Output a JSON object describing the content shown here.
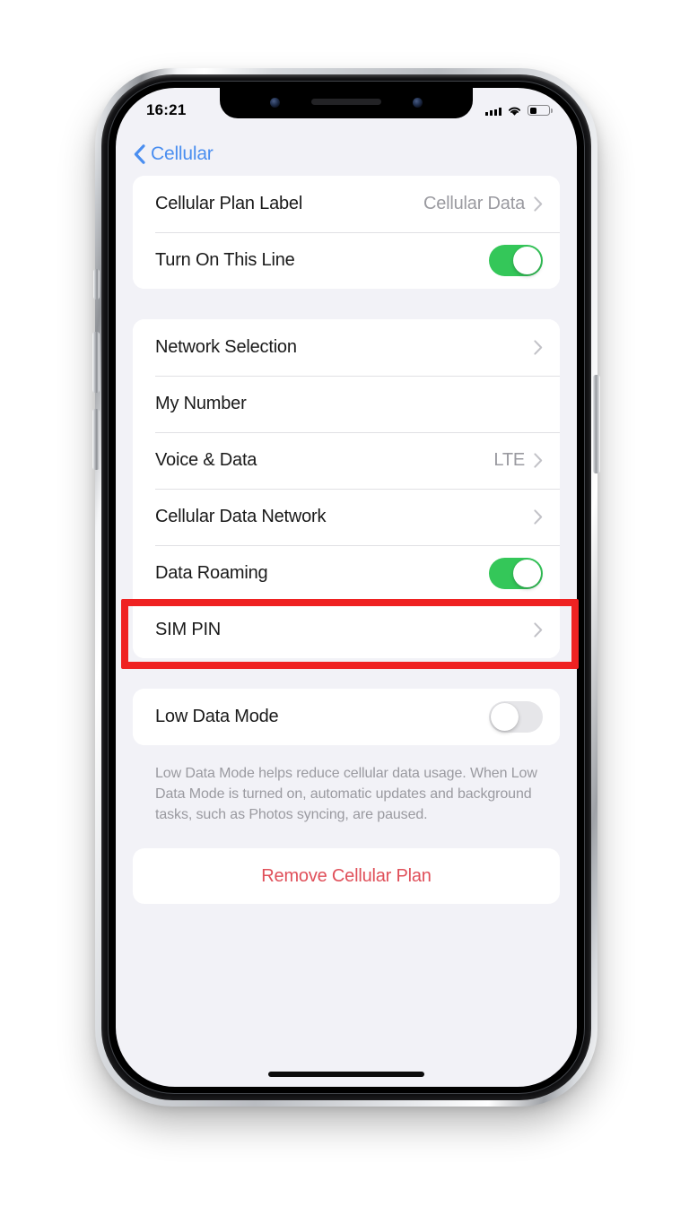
{
  "status_bar": {
    "time": "16:21",
    "cellular_icon": "cellular-bars-icon",
    "wifi_icon": "wifi-icon",
    "battery_icon": "battery-icon",
    "battery_level_percent": 32
  },
  "nav": {
    "back_icon": "chevron-left-icon",
    "back_label": "Cellular"
  },
  "groups": [
    {
      "rows": [
        {
          "label": "Cellular Plan Label",
          "value": "Cellular Data",
          "accessory": "chevron",
          "name": "row-cellular-plan-label"
        },
        {
          "label": "Turn On This Line",
          "accessory": "toggle",
          "toggle_state": "on",
          "name": "row-turn-on-this-line"
        }
      ]
    },
    {
      "rows": [
        {
          "label": "Network Selection",
          "value": "",
          "accessory": "chevron",
          "name": "row-network-selection"
        },
        {
          "label": "My Number",
          "value": "",
          "accessory": "none",
          "name": "row-my-number"
        },
        {
          "label": "Voice & Data",
          "value": "LTE",
          "accessory": "chevron",
          "name": "row-voice-and-data"
        },
        {
          "label": "Cellular Data Network",
          "value": "",
          "accessory": "chevron",
          "name": "row-cellular-data-network"
        },
        {
          "label": "Data Roaming",
          "accessory": "toggle",
          "toggle_state": "on",
          "name": "row-data-roaming"
        },
        {
          "label": "SIM PIN",
          "value": "",
          "accessory": "chevron",
          "name": "row-sim-pin"
        }
      ]
    },
    {
      "rows": [
        {
          "label": "Low Data Mode",
          "accessory": "toggle",
          "toggle_state": "off",
          "name": "row-low-data-mode"
        }
      ],
      "note": "Low Data Mode helps reduce cellular data usage. When Low Data Mode is turned on, automatic updates and background tasks, such as Photos syncing, are paused."
    }
  ],
  "destructive_action": {
    "label": "Remove Cellular Plan"
  },
  "annotation": {
    "highlight_target": "Data Roaming",
    "highlight_color": "#ef2222"
  },
  "colors": {
    "toggle_on": "#34C759",
    "toggle_off": "#E6E6E9",
    "accent_blue": "#4A8EF0",
    "destructive_red": "#E0505A",
    "screen_background": "#F2F2F7",
    "card_background": "#FFFFFF",
    "secondary_text": "#9A9AA0"
  },
  "home_indicator": "home-indicator"
}
